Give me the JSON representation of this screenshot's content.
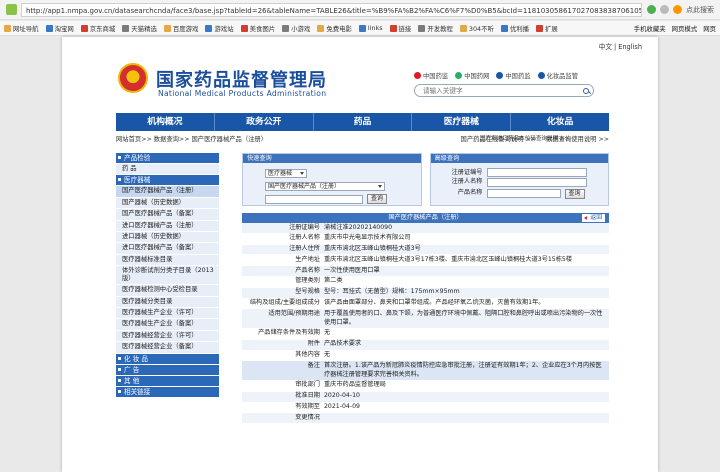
{
  "browser": {
    "url": "http://app1.nmpa.gov.cn/datasearchcnda/face3/base.jsp?tableId=26&tableName=TABLE26&title=%B9%FA%B2%FA%C6%F7%D0%B5&bcId=118103058617027083838706105",
    "search_hint": "点此搜索",
    "bookmarks": [
      "网址导航",
      "淘宝网",
      "京东商城",
      "天猫精选",
      "百度游戏",
      "游戏站",
      "美食图片",
      "小游戏",
      "免费电影",
      "links",
      "链接",
      "开发教程",
      "304不听",
      "优利播",
      "扩展"
    ],
    "bookmark_right": [
      "手机收藏夹",
      "网页模式",
      "网页"
    ]
  },
  "lang": [
    "中文",
    "English"
  ],
  "header": {
    "title": "国家药品监督管理局",
    "subtitle": "National Medical Products Administration",
    "social": [
      "中国药监",
      "中国药网",
      "中国药监",
      "化妆品监管"
    ],
    "search_placeholder": "请输入关键字"
  },
  "nav": [
    "机构概况",
    "政务公开",
    "药品",
    "医疗器械",
    "化妆品"
  ],
  "breadcrumb": {
    "path": "网站首页>> 数据查询>> 国产医疗器械产品（注册）",
    "links": [
      "国产药品在线查询说明 >>",
      "数据查询使用说明 >>"
    ],
    "top_link": "国产和进口药品本位码查询说明 >>"
  },
  "sidebar": [
    {
      "type": "head",
      "label": "产品检验"
    },
    {
      "type": "item",
      "label": "药    品"
    },
    {
      "type": "head",
      "label": "医疗器械"
    },
    {
      "type": "item",
      "label": "国产医疗器械产品（注册）",
      "active": true
    },
    {
      "type": "item",
      "label": "国产器械（历史数据）"
    },
    {
      "type": "item",
      "label": "国产医疗器械产品（备案）"
    },
    {
      "type": "item",
      "label": "进口医疗器械产品（注册）"
    },
    {
      "type": "item",
      "label": "进口器械（历史数据）"
    },
    {
      "type": "item",
      "label": "进口医疗器械产品（备案）"
    },
    {
      "type": "item",
      "label": "医疗器械标准目录"
    },
    {
      "type": "wrap",
      "label": "体外诊断试剂分类子目录（2013版）"
    },
    {
      "type": "item",
      "label": "医疗器械检测中心受检目录"
    },
    {
      "type": "item",
      "label": "医疗器械分类目录"
    },
    {
      "type": "item",
      "label": "医疗器械生产企业（许可）"
    },
    {
      "type": "item",
      "label": "医疗器械生产企业（备案）"
    },
    {
      "type": "item",
      "label": "医疗器械经营企业（许可）"
    },
    {
      "type": "item",
      "label": "医疗器械经营企业（备案）"
    },
    {
      "type": "head",
      "label": "化 妆 品"
    },
    {
      "type": "head",
      "label": "广    告"
    },
    {
      "type": "head",
      "label": "其    他"
    },
    {
      "type": "head",
      "label": "相关链接"
    }
  ],
  "quick_search": {
    "title": "快速查询",
    "select1": "医疗器械",
    "select2": "国产医疗器械产品（注册）",
    "button": "查询"
  },
  "advanced_search": {
    "title": "高级查询",
    "labels": [
      "注册证编号",
      "注册人名称",
      "产品名称"
    ],
    "button": "查询"
  },
  "result": {
    "title": "国产医疗器械产品（注册）",
    "back": "返回",
    "rows": [
      {
        "k": "注册证编号",
        "v": "渝械注准20202140090"
      },
      {
        "k": "注册人名称",
        "v": "重庆市中光电显示技术有限公司"
      },
      {
        "k": "注册人住所",
        "v": "重庆市渝北区玉峰山镇桐桂大道3号"
      },
      {
        "k": "生产地址",
        "v": "重庆市渝北区玉峰山镇桐桂大道3号17栋3楼、重庆市渝北区玉峰山镇桐桂大道3号15栋5楼"
      },
      {
        "k": "产品名称",
        "v": "一次性使用医用口罩"
      },
      {
        "k": "管理类别",
        "v": "第二类"
      },
      {
        "k": "型号规格",
        "v": "型号：耳挂式（无菌型）规格：175mm×95mm"
      },
      {
        "k": "结构及组成/主要组成成分",
        "v": "该产品由面罩部分、鼻夹和口罩带组成。产品经环氧乙烷灭菌，灭菌有效期1年。"
      },
      {
        "k": "适用范围/预期用途",
        "v": "用于覆盖使用者的口、鼻及下颌，为普通医疗环境中佩戴、阻隔口腔和鼻腔呼出或喷出污染物的一次性使用口罩。"
      },
      {
        "k": "产品储存条件及有效期",
        "v": "无"
      },
      {
        "k": "附件",
        "v": "产品技术要求"
      },
      {
        "k": "其他内容",
        "v": "无"
      },
      {
        "k": "备注",
        "v": "首次注册。1.该产品为新冠肺炎疫情防控应急审批注册，注册证有效期1年；2、企业应在3个月内按医疗器械注册管理要求完善相关资料。"
      },
      {
        "k": "审批部门",
        "v": "重庆市药品监督管理局"
      },
      {
        "k": "批准日期",
        "v": "2020-04-10"
      },
      {
        "k": "有效期至",
        "v": "2021-04-09"
      },
      {
        "k": "变更情况",
        "v": ""
      }
    ]
  },
  "colors": {
    "nav": "#1a56a7",
    "title": "#1b4f9c",
    "panel_head": "#3d72bd"
  }
}
